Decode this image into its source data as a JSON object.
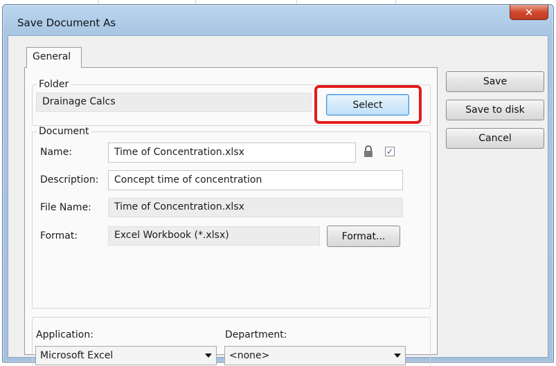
{
  "window": {
    "title": "Save Document As",
    "close_glyph": "✕"
  },
  "tabs": [
    {
      "label": "General"
    }
  ],
  "folder": {
    "label": "Folder",
    "value": "Drainage Calcs",
    "select_label": "Select"
  },
  "document": {
    "label": "Document",
    "name_label": "Name:",
    "name_value": "Time of Concentration.xlsx",
    "description_label": "Description:",
    "description_value": "Concept time of concentration",
    "filename_label": "File Name:",
    "filename_value": "Time of Concentration.xlsx",
    "format_label": "Format:",
    "format_value": "Excel Workbook (*.xlsx)",
    "format_button": "Format..."
  },
  "bottom": {
    "application_label": "Application:",
    "application_value": "Microsoft Excel",
    "department_label": "Department:",
    "department_value": "<none>"
  },
  "buttons": {
    "save": "Save",
    "save_to_disk": "Save to disk",
    "cancel": "Cancel"
  },
  "checkbox_mark": "✓",
  "icons": {
    "lock": "lock-icon",
    "dropdown": "chevron-down-icon",
    "close": "close-icon"
  },
  "colors": {
    "highlight": "#e51c1c",
    "focus_border": "#3c8fd9",
    "titlebar": "#a9c6e3"
  }
}
